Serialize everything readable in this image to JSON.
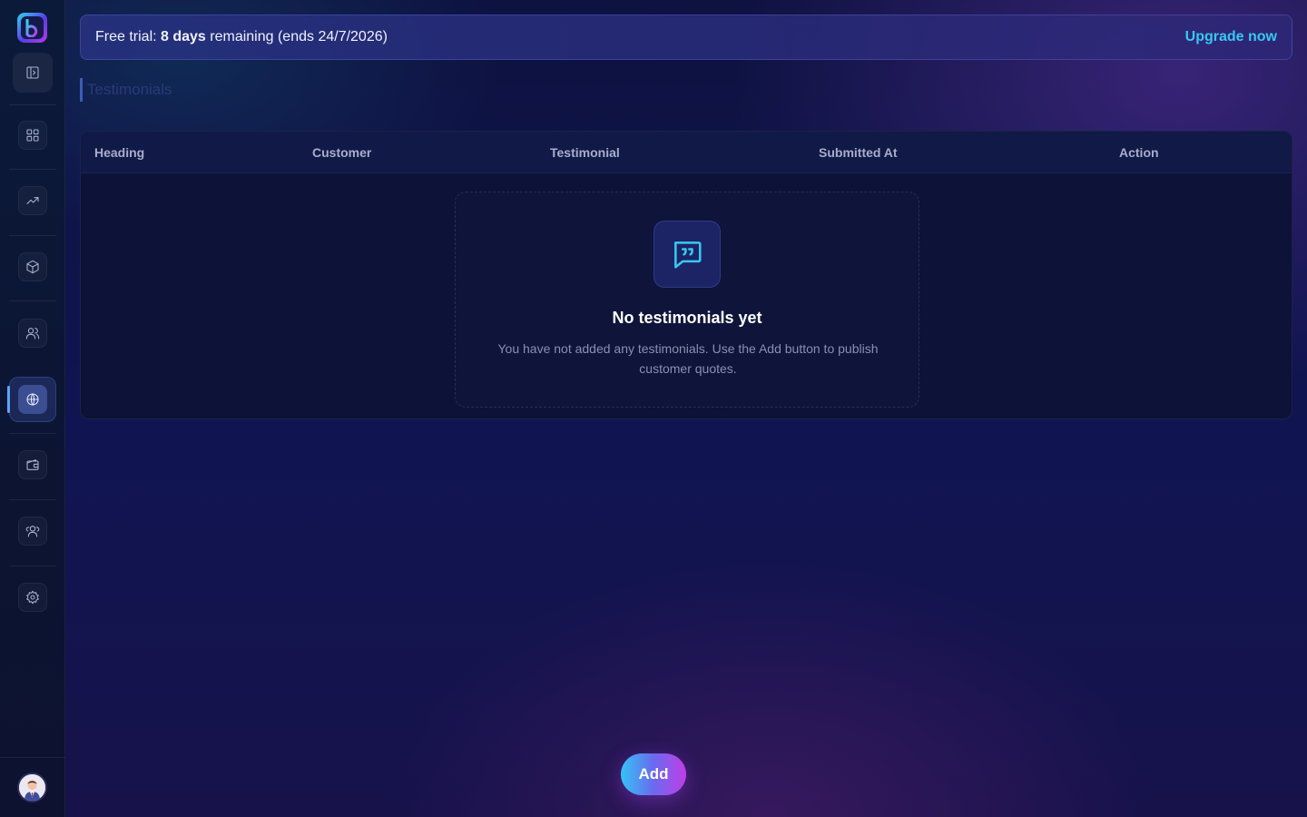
{
  "banner": {
    "prefix": "Free trial: ",
    "days": "8 days",
    "suffix": " remaining (ends 24/7/2026)",
    "upgrade_label": "Upgrade now"
  },
  "page": {
    "title": "Testimonials"
  },
  "table": {
    "columns": [
      "Heading",
      "Customer",
      "Testimonial",
      "Submitted At",
      "Action"
    ],
    "rows": []
  },
  "empty_state": {
    "title": "No testimonials yet",
    "description": "You have not added any testimonials. Use the Add button to publish customer quotes."
  },
  "actions": {
    "add_label": "Add"
  },
  "sidebar": {
    "items": [
      {
        "icon": "dashboard-icon"
      },
      {
        "icon": "trending-up-icon"
      },
      {
        "icon": "package-icon"
      },
      {
        "icon": "users-icon"
      },
      {
        "icon": "globe-icon",
        "active": true
      },
      {
        "icon": "wallet-icon"
      },
      {
        "icon": "team-icon"
      },
      {
        "icon": "settings-icon"
      }
    ]
  },
  "colors": {
    "accent": "#38c8f0",
    "gradient_start": "#35c3f5",
    "gradient_end": "#c03ee6",
    "background": "#101552"
  }
}
